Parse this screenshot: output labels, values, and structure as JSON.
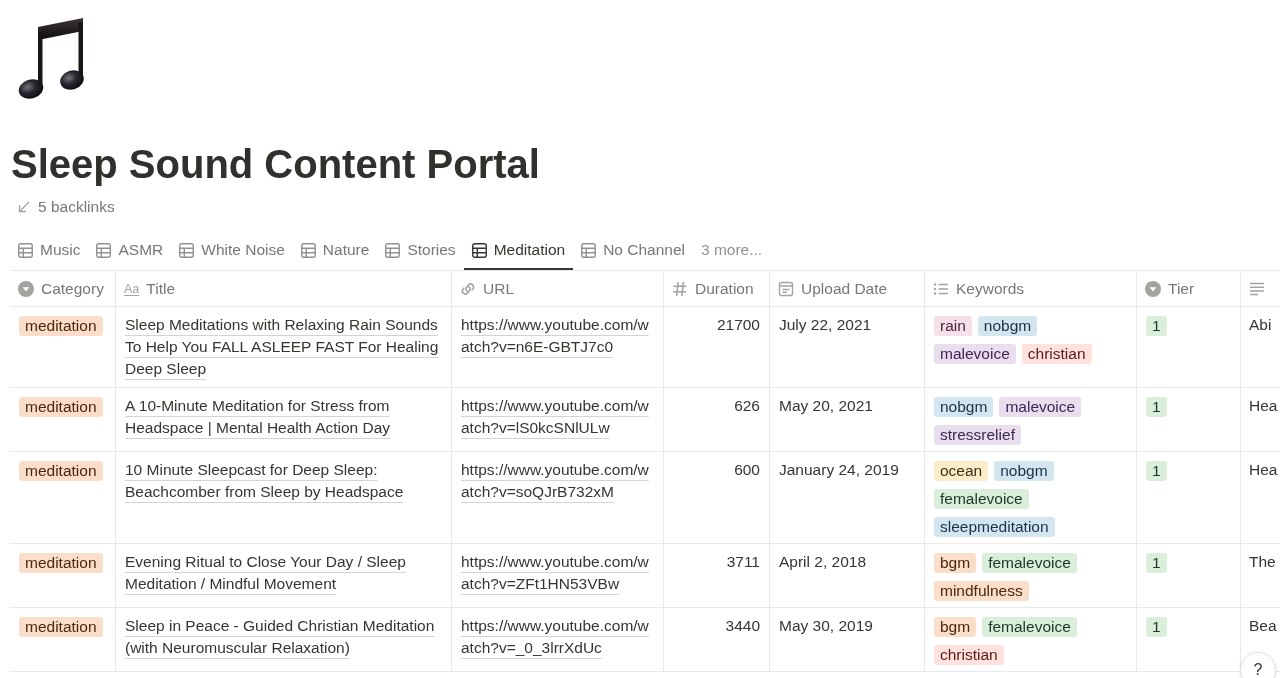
{
  "page": {
    "title": "Sleep Sound Content Portal",
    "backlinks": "5 backlinks"
  },
  "view_tabs": [
    {
      "label": "Music",
      "selected": false
    },
    {
      "label": "ASMR",
      "selected": false
    },
    {
      "label": "White Noise",
      "selected": false
    },
    {
      "label": "Nature",
      "selected": false
    },
    {
      "label": "Stories",
      "selected": false
    },
    {
      "label": "Meditation",
      "selected": true
    },
    {
      "label": "No Channel",
      "selected": false
    }
  ],
  "more_views": "3 more...",
  "table": {
    "columns": [
      {
        "label": "Category",
        "kind": "select"
      },
      {
        "label": "Title",
        "kind": "title",
        "icon_text": "Aa"
      },
      {
        "label": "URL",
        "kind": "url"
      },
      {
        "label": "Duration",
        "kind": "number"
      },
      {
        "label": "Upload Date",
        "kind": "date"
      },
      {
        "label": "Keywords",
        "kind": "multi_select"
      },
      {
        "label": "Tier",
        "kind": "select"
      },
      {
        "kind": "text"
      }
    ],
    "rows": [
      {
        "category": {
          "label": "meditation",
          "color": "#fadec9"
        },
        "title": "Sleep Meditations with Relaxing Rain Sounds To Help You FALL ASLEEP FAST For Healing Deep Sleep",
        "url": "https://www.youtube.com/watch?v=n6E-GBTJ7c0",
        "duration": "21700",
        "upload_date": "July 22, 2021",
        "keywords": [
          {
            "label": "rain",
            "color": "#f5e0e9"
          },
          {
            "label": "nobgm",
            "color": "#d3e5ef"
          },
          {
            "label": "malevoice",
            "color": "#e8deee"
          },
          {
            "label": "christian",
            "color": "#ffe2dd"
          }
        ],
        "tier": {
          "label": "1",
          "color": "#dbeddb"
        },
        "column_8": "Abi"
      },
      {
        "category": {
          "label": "meditation",
          "color": "#fadec9"
        },
        "title": "A 10-Minute Meditation for Stress from Headspace | Mental Health Action Day",
        "url": "https://www.youtube.com/watch?v=lS0kcSNlULw",
        "duration": "626",
        "upload_date": "May 20, 2021",
        "keywords": [
          {
            "label": "nobgm",
            "color": "#d3e5ef"
          },
          {
            "label": "malevoice",
            "color": "#e8deee"
          },
          {
            "label": "stressrelief",
            "color": "#e8deee"
          }
        ],
        "tier": {
          "label": "1",
          "color": "#dbeddb"
        },
        "column_8": "Hea"
      },
      {
        "category": {
          "label": "meditation",
          "color": "#fadec9"
        },
        "title": "10 Minute Sleepcast for Deep Sleep: Beachcomber from Sleep by Headspace",
        "url": "https://www.youtube.com/watch?v=soQJrB732xM",
        "duration": "600",
        "upload_date": "January 24, 2019",
        "keywords": [
          {
            "label": "ocean",
            "color": "#fdecc8"
          },
          {
            "label": "nobgm",
            "color": "#d3e5ef"
          },
          {
            "label": "femalevoice",
            "color": "#dbeddb"
          },
          {
            "label": "sleepmeditation",
            "color": "#d3e5ef"
          }
        ],
        "tier": {
          "label": "1",
          "color": "#dbeddb"
        },
        "column_8": "Hea"
      },
      {
        "category": {
          "label": "meditation",
          "color": "#fadec9"
        },
        "title": "Evening Ritual to Close Your Day / Sleep Meditation / Mindful Movement",
        "url": "https://www.youtube.com/watch?v=ZFt1HN53VBw",
        "duration": "3711",
        "upload_date": "April 2, 2018",
        "keywords": [
          {
            "label": "bgm",
            "color": "#fadec9"
          },
          {
            "label": "femalevoice",
            "color": "#dbeddb"
          },
          {
            "label": "mindfulness",
            "color": "#fadec9"
          }
        ],
        "tier": {
          "label": "1",
          "color": "#dbeddb"
        },
        "column_8": "The"
      },
      {
        "category": {
          "label": "meditation",
          "color": "#fadec9"
        },
        "title": "Sleep in Peace - Guided Christian Meditation (with Neuromuscular Relaxation)",
        "url": "https://www.youtube.com/watch?v=_0_3lrrXdUc",
        "duration": "3440",
        "upload_date": "May 30, 2019",
        "keywords": [
          {
            "label": "bgm",
            "color": "#fadec9"
          },
          {
            "label": "femalevoice",
            "color": "#dbeddb"
          },
          {
            "label": "christian",
            "color": "#ffe2dd"
          }
        ],
        "tier": {
          "label": "1",
          "color": "#dbeddb"
        },
        "column_8": "Bea"
      }
    ]
  },
  "help_button": {
    "label": "?"
  }
}
